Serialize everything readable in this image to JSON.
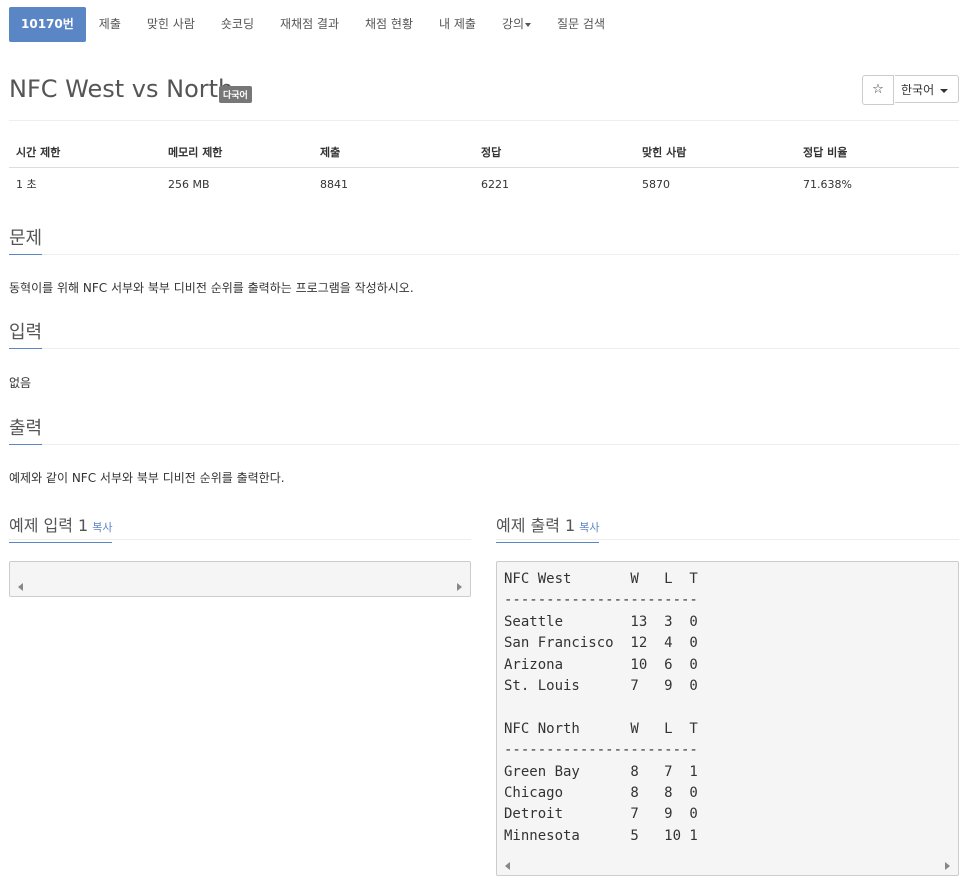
{
  "nav": {
    "items": [
      "10170번",
      "제출",
      "맞힌 사람",
      "숏코딩",
      "재채점 결과",
      "채점 현황",
      "내 제출",
      "강의",
      "질문 검색"
    ]
  },
  "title": {
    "text": "NFC West vs North",
    "badge": "다국어",
    "star": "☆",
    "language": "한국어"
  },
  "stats": {
    "headers": [
      "시간 제한",
      "메모리 제한",
      "제출",
      "정답",
      "맞힌 사람",
      "정답 비율"
    ],
    "values": [
      "1 초",
      "256 MB",
      "8841",
      "6221",
      "5870",
      "71.638%"
    ]
  },
  "problem": {
    "heading": "문제",
    "text": "동혁이를 위해 NFC 서부와 북부 디비전 순위를 출력하는 프로그램을 작성하시오."
  },
  "input": {
    "heading": "입력",
    "text": "없음"
  },
  "output": {
    "heading": "출력",
    "text": "예제와 같이 NFC 서부와 북부 디비전 순위를 출력한다."
  },
  "sample_input": {
    "heading": "예제 입력 1",
    "copy": "복사",
    "content": ""
  },
  "sample_output": {
    "heading": "예제 출력 1",
    "copy": "복사",
    "content": "NFC West       W   L  T\n-----------------------\nSeattle        13  3  0\nSan Francisco  12  4  0\nArizona        10  6  0\nSt. Louis      7   9  0\n\nNFC North      W   L  T\n-----------------------\nGreen Bay      8   7  1\nChicago        8   8  0\nDetroit        7   9  0\nMinnesota      5   10 1"
  },
  "colors": {
    "accent": "#5b86c5",
    "badge": "#777777"
  }
}
